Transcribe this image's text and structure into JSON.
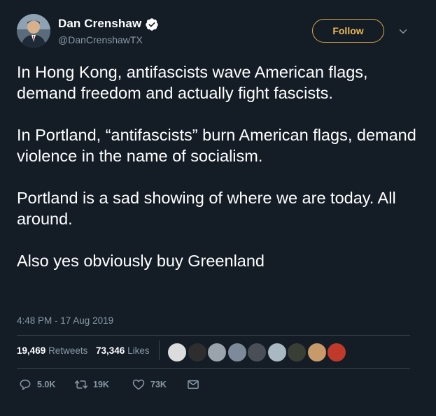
{
  "author": {
    "name": "Dan Crenshaw",
    "handle": "@DanCrenshawTX",
    "follow_label": "Follow"
  },
  "tweet": {
    "paragraphs": [
      "In Hong Kong, antifascists wave American flags, demand freedom and actually fight fascists.",
      "In Portland, “antifascists” burn American flags, demand violence in the name of socialism.",
      "Portland is a sad showing of where we are today. All around.",
      "Also yes obviously buy Greenland"
    ],
    "timestamp": "4:48 PM - 17 Aug 2019"
  },
  "stats": {
    "retweets_count": "19,469",
    "retweets_label": "Retweets",
    "likes_count": "73,346",
    "likes_label": "Likes",
    "liker_avatars": [
      {
        "name": "liker-avatar-1",
        "color": "#dcdcdc"
      },
      {
        "name": "liker-avatar-2",
        "color": "#2e2e2e"
      },
      {
        "name": "liker-avatar-3",
        "color": "#9aa3ab"
      },
      {
        "name": "liker-avatar-4",
        "color": "#7d8a99"
      },
      {
        "name": "liker-avatar-5",
        "color": "#4a4f57"
      },
      {
        "name": "liker-avatar-6",
        "color": "#aab8c2"
      },
      {
        "name": "liker-avatar-7",
        "color": "#3a3f35"
      },
      {
        "name": "liker-avatar-8",
        "color": "#c89a6a"
      },
      {
        "name": "liker-avatar-9",
        "color": "#c0392b"
      }
    ]
  },
  "actions": {
    "reply_count": "5.0K",
    "retweet_count": "19K",
    "like_count": "73K"
  },
  "colors": {
    "background": "#141d26",
    "follow_accent": "#e8b657",
    "muted_text": "#8899a6",
    "divider": "#38444d"
  }
}
